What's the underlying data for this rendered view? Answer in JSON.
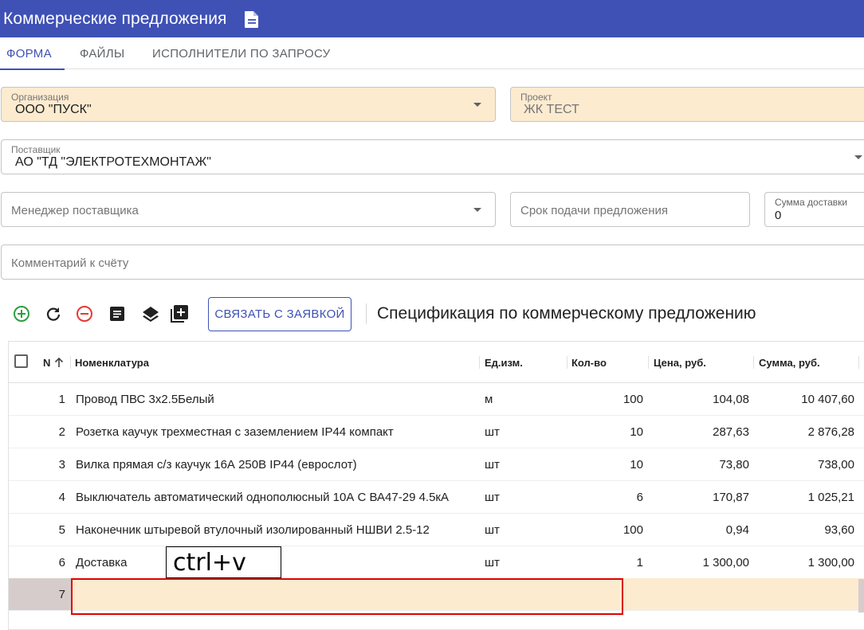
{
  "app": {
    "title": "Коммерческие предложения",
    "accent": "#3f51b5"
  },
  "tabs": [
    {
      "label": "ФОРМА",
      "active": true
    },
    {
      "label": "ФАЙЛЫ",
      "active": false
    },
    {
      "label": "ИСПОЛНИТЕЛИ ПО ЗАПРОСУ",
      "active": false
    }
  ],
  "form": {
    "organization": {
      "label": "Организация",
      "value": "ООО \"ПУСК\""
    },
    "project": {
      "label": "Проект",
      "value": "ЖК ТЕСТ"
    },
    "supplier": {
      "label": "Поставщик",
      "value": "АО \"ТД \"ЭЛЕКТРОТЕХМОНТАЖ\""
    },
    "manager": {
      "placeholder": "Менеджер поставщика"
    },
    "deadline": {
      "placeholder": "Срок подачи предложения"
    },
    "delivery_sum": {
      "label": "Сумма доставки",
      "value": "0"
    },
    "comment": {
      "placeholder": "Комментарий к счёту"
    }
  },
  "toolbar": {
    "icons": [
      "add-circle-icon",
      "refresh-icon",
      "remove-circle-icon",
      "list-icon",
      "layers-icon",
      "add-box-icon"
    ],
    "link_button": "СВЯЗАТЬ С ЗАЯВКОЙ",
    "spec_title": "Спецификация по коммерческому предложению"
  },
  "table": {
    "headers": {
      "n": "N",
      "name": "Номенклатура",
      "unit": "Ед.изм.",
      "qty": "Кол-во",
      "price": "Цена, руб.",
      "sum": "Сумма, руб."
    },
    "rows": [
      {
        "n": "1",
        "name": "Провод ПВС 3х2.5Белый",
        "unit": "м",
        "qty": "100",
        "price": "104,08",
        "sum": "10 407,60"
      },
      {
        "n": "2",
        "name": "Розетка каучук трехместная с заземлением IP44 компакт",
        "unit": "шт",
        "qty": "10",
        "price": "287,63",
        "sum": "2 876,28"
      },
      {
        "n": "3",
        "name": "Вилка прямая с/з каучук 16А 250В IP44 (еврослот)",
        "unit": "шт",
        "qty": "10",
        "price": "73,80",
        "sum": "738,00"
      },
      {
        "n": "4",
        "name": "Выключатель автоматический однополюсный 10А С ВА47-29 4.5кА",
        "unit": "шт",
        "qty": "6",
        "price": "170,87",
        "sum": "1 025,21"
      },
      {
        "n": "5",
        "name": "Наконечник штыревой втулочный изолированный НШВИ 2.5-12",
        "unit": "шт",
        "qty": "100",
        "price": "0,94",
        "sum": "93,60"
      },
      {
        "n": "6",
        "name": "Доставка",
        "unit": "шт",
        "qty": "1",
        "price": "1 300,00",
        "sum": "1 300,00"
      }
    ],
    "new_row": {
      "n": "7"
    }
  },
  "annotation": {
    "text": "ctrl+v"
  }
}
